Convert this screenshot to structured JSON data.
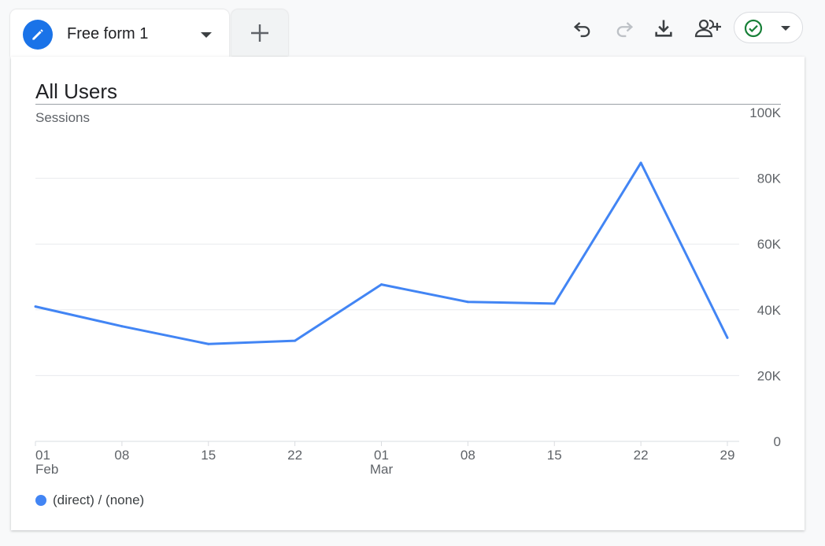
{
  "tabs": {
    "active_title": "Free form 1",
    "accent_color": "#1a73e8"
  },
  "toolbar": {
    "icons": [
      "undo-icon",
      "redo-icon",
      "download-icon",
      "share-users-icon",
      "check-circle-icon",
      "dropdown-arrow-icon"
    ]
  },
  "chart_data": {
    "type": "line",
    "title": "All Users",
    "ylabel": "Sessions",
    "x": [
      "01 Feb",
      "08 Feb",
      "15 Feb",
      "22 Feb",
      "01 Mar",
      "08 Mar",
      "15 Mar",
      "22 Mar",
      "29 Mar"
    ],
    "x_tick_top": [
      "01",
      "08",
      "15",
      "22",
      "01",
      "08",
      "15",
      "22",
      "29"
    ],
    "x_tick_bottom": [
      "Feb",
      "",
      "",
      "",
      "Mar",
      "",
      "",
      "",
      ""
    ],
    "series": [
      {
        "name": "(direct) / (none)",
        "color": "#4285f4",
        "values": [
          41000,
          35000,
          29600,
          30600,
          47700,
          42400,
          41900,
          84700,
          31500
        ]
      }
    ],
    "y_ticks": [
      "0",
      "20K",
      "40K",
      "60K",
      "80K",
      "100K"
    ],
    "y_tick_values": [
      0,
      20000,
      40000,
      60000,
      80000,
      100000
    ],
    "ylim": [
      0,
      100000
    ],
    "y_axis_side": "right",
    "grid": true,
    "legend_position": "bottom-left"
  }
}
